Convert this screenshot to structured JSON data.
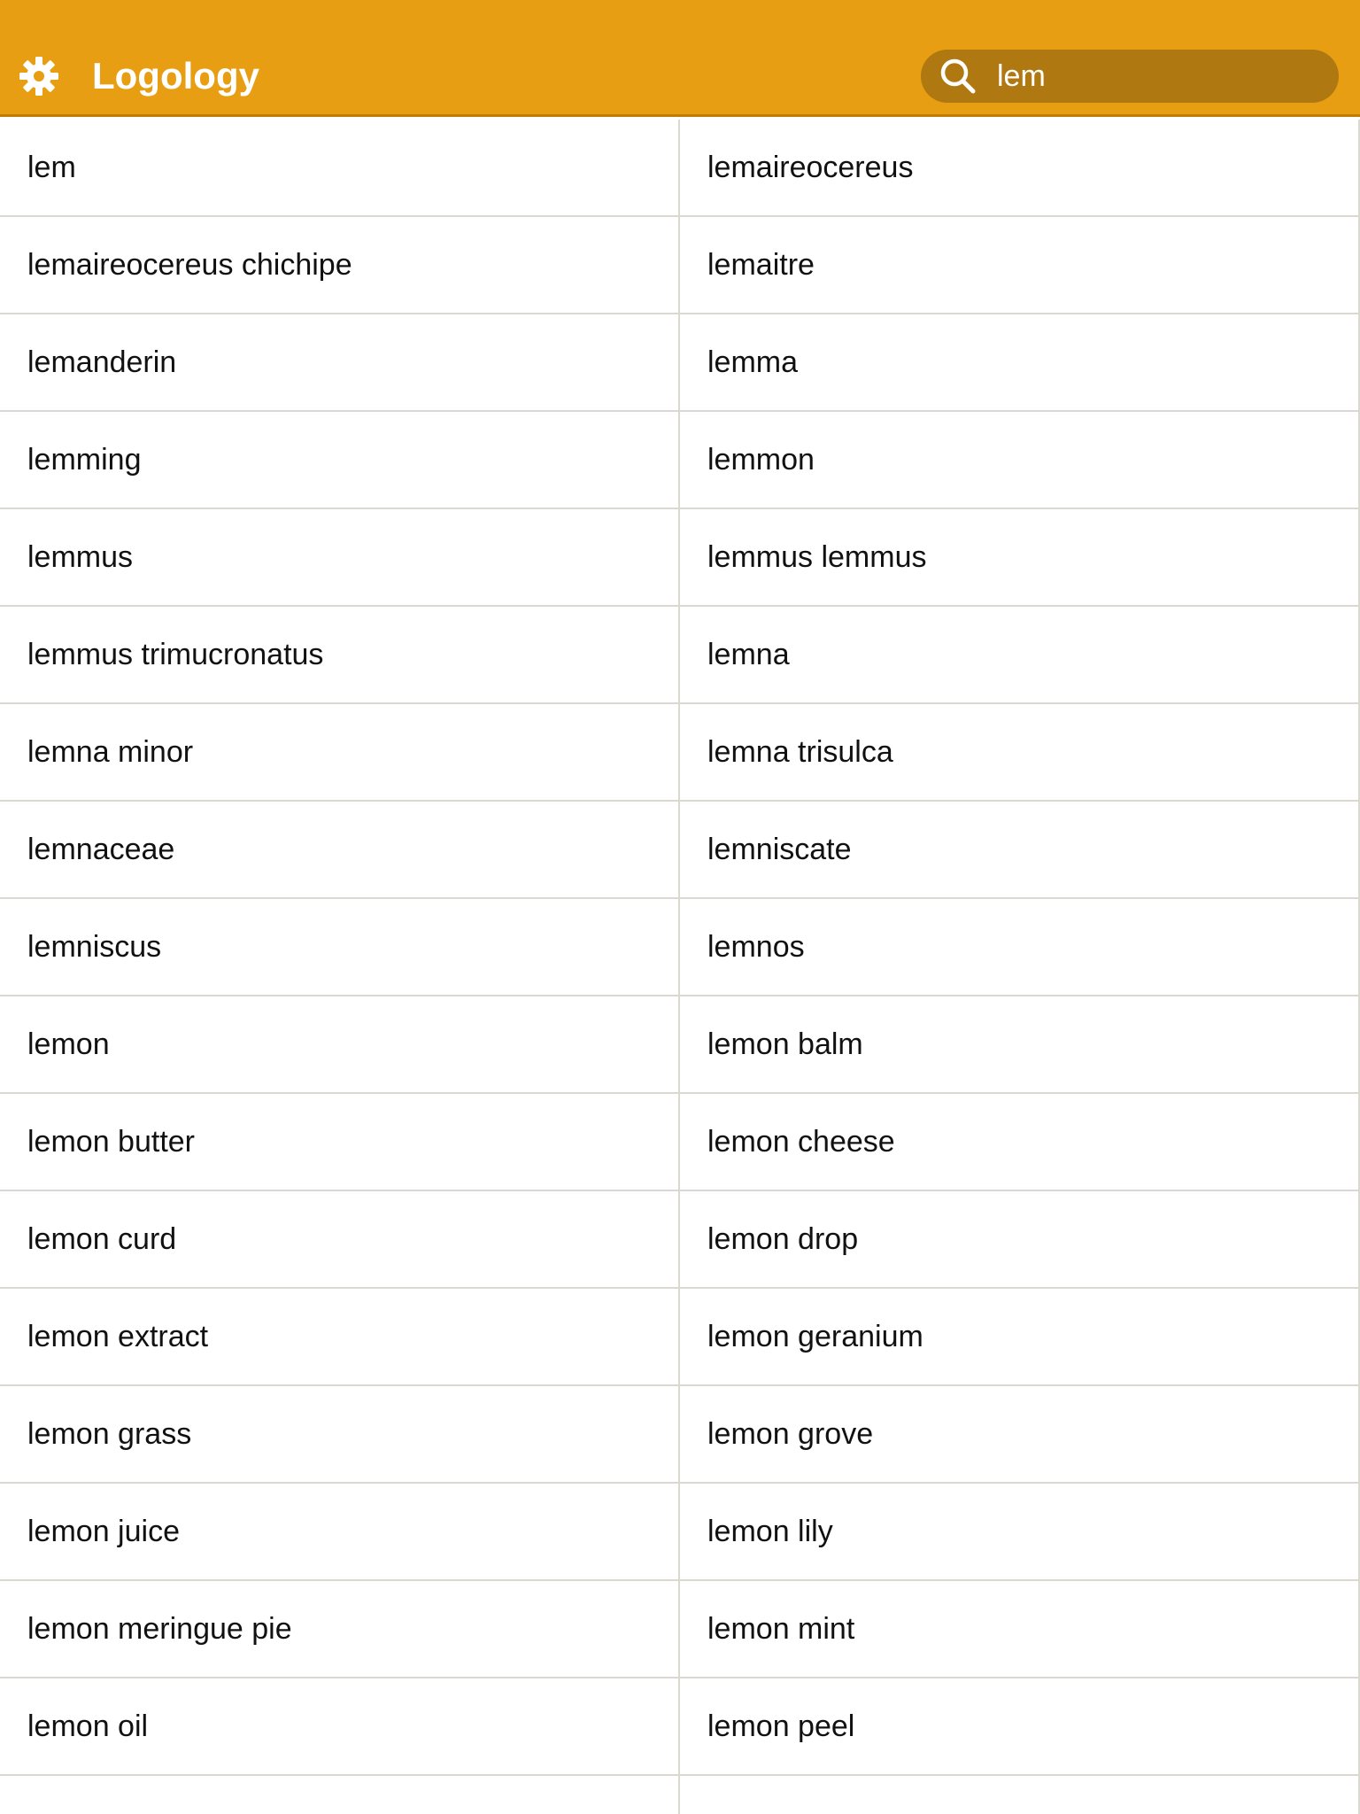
{
  "app": {
    "title": "Logology",
    "settings_icon": "gear-icon"
  },
  "colors": {
    "header_bg": "#E89E12",
    "search_bg": "#B07810",
    "divider": "#DAD8D0"
  },
  "search": {
    "icon": "search-icon",
    "value": "lem",
    "placeholder": ""
  },
  "results": [
    "lem",
    "lemaireocereus",
    "lemaireocereus chichipe",
    "lemaitre",
    "lemanderin",
    "lemma",
    "lemming",
    "lemmon",
    "lemmus",
    "lemmus lemmus",
    "lemmus trimucronatus",
    "lemna",
    "lemna minor",
    "lemna trisulca",
    "lemnaceae",
    "lemniscate",
    "lemniscus",
    "lemnos",
    "lemon",
    "lemon balm",
    "lemon butter",
    "lemon cheese",
    "lemon curd",
    "lemon drop",
    "lemon extract",
    "lemon geranium",
    "lemon grass",
    "lemon grove",
    "lemon juice",
    "lemon lily",
    "lemon meringue pie",
    "lemon mint",
    "lemon oil",
    "lemon peel",
    "",
    ""
  ]
}
